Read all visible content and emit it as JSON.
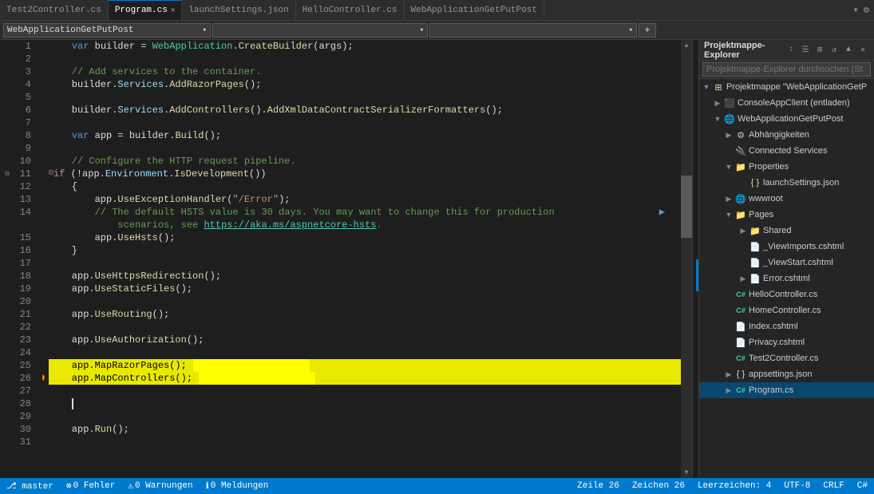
{
  "tabs": [
    {
      "id": "tab1",
      "label": "Test2Controller.cs",
      "active": false,
      "modified": false,
      "pinned": false
    },
    {
      "id": "tab2",
      "label": "Program.cs",
      "active": true,
      "modified": true,
      "pinned": false
    },
    {
      "id": "tab3",
      "label": "launchSettings.json",
      "active": false,
      "modified": false,
      "pinned": false
    },
    {
      "id": "tab4",
      "label": "HelloController.cs",
      "active": false,
      "modified": false,
      "pinned": false
    },
    {
      "id": "tab5",
      "label": "WebApplicationGetPutPost",
      "active": false,
      "modified": false,
      "pinned": false
    }
  ],
  "toolbar": {
    "project_dropdown": "WebApplicationGetPutPost",
    "file_dropdown": "",
    "member_dropdown": "",
    "add_btn": "+"
  },
  "code_lines": [
    {
      "num": 1,
      "content": "    var builder = WebApplication.CreateBuilder(args);",
      "highlight": false,
      "bookmark": false
    },
    {
      "num": 2,
      "content": "",
      "highlight": false,
      "bookmark": false
    },
    {
      "num": 3,
      "content": "    // Add services to the container.",
      "highlight": false,
      "bookmark": false,
      "comment": true
    },
    {
      "num": 4,
      "content": "    builder.Services.AddRazorPages();",
      "highlight": false,
      "bookmark": false
    },
    {
      "num": 5,
      "content": "",
      "highlight": false,
      "bookmark": false
    },
    {
      "num": 6,
      "content": "    builder.Services.AddControllers().AddXmlDataContractSerializerFormatters();",
      "highlight": false,
      "bookmark": false
    },
    {
      "num": 7,
      "content": "",
      "highlight": false,
      "bookmark": false
    },
    {
      "num": 8,
      "content": "    var app = builder.Build();",
      "highlight": false,
      "bookmark": false
    },
    {
      "num": 9,
      "content": "",
      "highlight": false,
      "bookmark": false
    },
    {
      "num": 10,
      "content": "    // Configure the HTTP request pipeline.",
      "highlight": false,
      "bookmark": false,
      "comment": true
    },
    {
      "num": 11,
      "content": "if (!app.Environment.IsDevelopment())",
      "highlight": false,
      "bookmark": false,
      "fold": true
    },
    {
      "num": 12,
      "content": "    {",
      "highlight": false,
      "bookmark": false
    },
    {
      "num": 13,
      "content": "        app.UseExceptionHandler(\"/Error\");",
      "highlight": false,
      "bookmark": false
    },
    {
      "num": 14,
      "content": "        // The default HSTS value is 30 days. You may want to change this for production",
      "highlight": false,
      "bookmark": false,
      "comment": true
    },
    {
      "num": "14b",
      "content": "            scenarios, see https://aka.ms/aspnetcore-hsts.",
      "highlight": false,
      "bookmark": false,
      "comment": true,
      "continuation": true
    },
    {
      "num": 15,
      "content": "        app.UseHsts();",
      "highlight": false,
      "bookmark": false
    },
    {
      "num": 16,
      "content": "    }",
      "highlight": false,
      "bookmark": false
    },
    {
      "num": 17,
      "content": "",
      "highlight": false,
      "bookmark": false
    },
    {
      "num": 18,
      "content": "    app.UseHttpsRedirection();",
      "highlight": false,
      "bookmark": false
    },
    {
      "num": 19,
      "content": "    app.UseStaticFiles();",
      "highlight": false,
      "bookmark": false
    },
    {
      "num": 20,
      "content": "",
      "highlight": false,
      "bookmark": false
    },
    {
      "num": 21,
      "content": "    app.UseRouting();",
      "highlight": false,
      "bookmark": false
    },
    {
      "num": 22,
      "content": "",
      "highlight": false,
      "bookmark": false
    },
    {
      "num": 23,
      "content": "    app.UseAuthorization();",
      "highlight": false,
      "bookmark": true,
      "green_bar": true
    },
    {
      "num": 24,
      "content": "",
      "highlight": false,
      "bookmark": false
    },
    {
      "num": 25,
      "content": "    app.MapRazorPages();",
      "highlight": true,
      "bookmark": false
    },
    {
      "num": 26,
      "content": "    app.MapControllers();",
      "highlight": true,
      "bookmark": false,
      "debugger": true
    },
    {
      "num": 27,
      "content": "",
      "highlight": false,
      "bookmark": false
    },
    {
      "num": 28,
      "content": "    |",
      "highlight": false,
      "bookmark": false
    },
    {
      "num": 29,
      "content": "",
      "highlight": false,
      "bookmark": false
    },
    {
      "num": 30,
      "content": "    app.Run();",
      "highlight": false,
      "bookmark": false
    },
    {
      "num": 31,
      "content": "",
      "highlight": false,
      "bookmark": false
    }
  ],
  "solution_explorer": {
    "title": "Projektmappe-Explorer",
    "search_placeholder": "Projektmappe-Explorer durchsuchen (St",
    "toolbar_buttons": [
      "sync",
      "properties",
      "show-all",
      "refresh",
      "collapse"
    ],
    "tree": [
      {
        "id": "solution",
        "label": "Projektmappe \"WebApplicationGetP",
        "level": 0,
        "icon": "solution",
        "expanded": true
      },
      {
        "id": "console",
        "label": "ConsoleAppClient (entladen)",
        "level": 1,
        "icon": "project",
        "expanded": false
      },
      {
        "id": "webapp",
        "label": "WebApplicationGetPutPost",
        "level": 1,
        "icon": "project-web",
        "expanded": true
      },
      {
        "id": "dependencies",
        "label": "Abhängigkeiten",
        "level": 2,
        "icon": "dependencies",
        "expanded": false
      },
      {
        "id": "connected",
        "label": "Connected Services",
        "level": 2,
        "icon": "connected",
        "expanded": false
      },
      {
        "id": "properties",
        "label": "Properties",
        "level": 2,
        "icon": "folder",
        "expanded": true
      },
      {
        "id": "launchsettings",
        "label": "launchSettings.json",
        "level": 3,
        "icon": "json",
        "expanded": false
      },
      {
        "id": "wwwroot",
        "label": "wwwroot",
        "level": 2,
        "icon": "folder-web",
        "expanded": false
      },
      {
        "id": "pages",
        "label": "Pages",
        "level": 2,
        "icon": "folder",
        "expanded": true
      },
      {
        "id": "shared",
        "label": "Shared",
        "level": 3,
        "icon": "folder",
        "expanded": false
      },
      {
        "id": "viewimports",
        "label": "_ViewImports.cshtml",
        "level": 3,
        "icon": "cshtml",
        "expanded": false
      },
      {
        "id": "viewstart",
        "label": "_ViewStart.cshtml",
        "level": 3,
        "icon": "cshtml",
        "expanded": false
      },
      {
        "id": "error",
        "label": "Error.cshtml",
        "level": 3,
        "icon": "cshtml",
        "expanded": false
      },
      {
        "id": "hellocontroller",
        "label": "HelloController.cs",
        "level": 2,
        "icon": "cs",
        "expanded": false
      },
      {
        "id": "homecontroller",
        "label": "HomeController.cs",
        "level": 2,
        "icon": "cs",
        "expanded": false
      },
      {
        "id": "index",
        "label": "Index.cshtml",
        "level": 2,
        "icon": "cshtml",
        "expanded": false
      },
      {
        "id": "privacy",
        "label": "Privacy.cshtml",
        "level": 2,
        "icon": "cshtml",
        "expanded": false
      },
      {
        "id": "test2controller",
        "label": "Test2Controller.cs",
        "level": 2,
        "icon": "cs",
        "expanded": false
      },
      {
        "id": "appsettings",
        "label": "appsettings.json",
        "level": 2,
        "icon": "json",
        "expanded": false
      },
      {
        "id": "program",
        "label": "Program.cs",
        "level": 2,
        "icon": "cs",
        "expanded": false,
        "selected": true
      }
    ]
  },
  "status_bar": {
    "branch": "master",
    "errors": "0 Fehler",
    "warnings": "0 Warnungen",
    "messages": "0 Meldungen",
    "line": "Zeile 26",
    "col": "Zeichen 26",
    "spaces": "Leerzeichen: 4",
    "encoding": "UTF-8",
    "line_endings": "CRLF",
    "lang": "C#"
  }
}
